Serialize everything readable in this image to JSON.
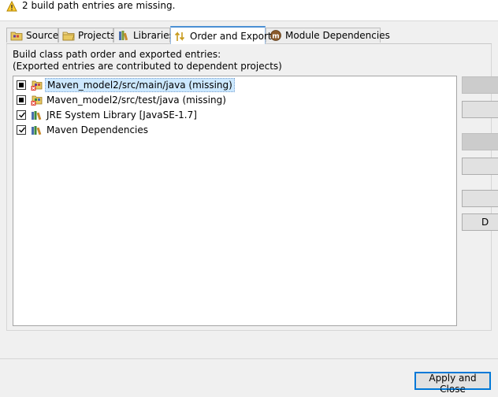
{
  "warning": {
    "icon": "warning-icon",
    "message": "2 build path entries are missing."
  },
  "tabs": [
    {
      "label": "Source",
      "icon": "source-folder-icon",
      "active": false
    },
    {
      "label": "Projects",
      "icon": "projects-icon",
      "active": false
    },
    {
      "label": "Libraries",
      "icon": "libraries-icon",
      "active": false
    },
    {
      "label": "Order and Export",
      "icon": "order-export-icon",
      "active": true
    },
    {
      "label": "Module Dependencies",
      "icon": "module-icon",
      "active": false
    }
  ],
  "description": {
    "line1": "Build class path order and exported entries:",
    "line2": "(Exported entries are contributed to dependent projects)"
  },
  "entries": [
    {
      "label": "Maven_model2/src/main/java (missing)",
      "check_state": "mixed",
      "icon": "missing-source-folder-icon",
      "selected": true
    },
    {
      "label": "Maven_model2/src/test/java (missing)",
      "check_state": "mixed",
      "icon": "missing-source-folder-icon",
      "selected": false
    },
    {
      "label": "JRE System Library [JavaSE-1.7]",
      "check_state": "checked",
      "icon": "library-icon",
      "selected": false
    },
    {
      "label": "Maven Dependencies",
      "check_state": "checked",
      "icon": "library-icon",
      "selected": false
    }
  ],
  "side_buttons": [
    {
      "label": "",
      "enabled": false
    },
    {
      "label": "",
      "enabled": true
    },
    {
      "label": "",
      "enabled": false
    },
    {
      "label": "",
      "enabled": true
    },
    {
      "label": "",
      "enabled": true
    },
    {
      "label": "D",
      "enabled": true
    }
  ],
  "apply_close_label": "Apply and Close",
  "colors": {
    "accent": "#0078d7",
    "tab_active_border": "#4a8fd4",
    "selection": "#cce8ff",
    "window_bg": "#f0f0f0"
  }
}
